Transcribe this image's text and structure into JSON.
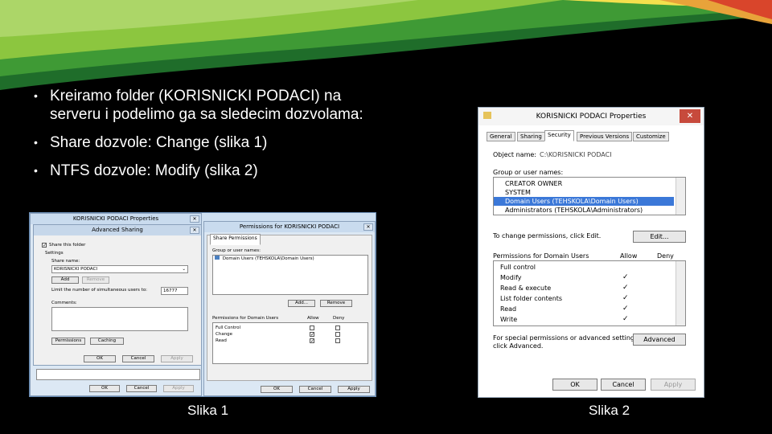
{
  "slide": {
    "bullets": [
      "Kreiramo folder (KORISNICKI PODACI) na serveru i podelimo ga sa sledecim dozvolama:",
      "Share dozvole: Change (slika 1)",
      "NTFS dozvole: Modify (slika 2)"
    ],
    "captions": [
      "Slika 1",
      "Slika 2"
    ]
  },
  "slika1": {
    "bg_title": "KORISNICKI PODACI Properties",
    "adv": {
      "title": "Advanced Sharing",
      "share_this_folder": "Share this folder",
      "settings": "Settings",
      "share_name_label": "Share name:",
      "share_name": "KORISNICKI PODACI",
      "add": "Add",
      "remove": "Remove",
      "limit_label": "Limit the number of simultaneous users to:",
      "limit_value": "16777",
      "comments": "Comments:",
      "permissions": "Permissions",
      "caching": "Caching",
      "ok": "OK",
      "cancel": "Cancel",
      "apply": "Apply"
    },
    "perm": {
      "title": "Permissions for KORISNICKI PODACI",
      "tab": "Share Permissions",
      "group_label": "Group or user names:",
      "group_item": "Domain Users (TEHSKOLA\\Domain Users)",
      "add": "Add...",
      "remove": "Remove",
      "perms_label": "Permissions for Domain Users",
      "allow": "Allow",
      "deny": "Deny",
      "rows": [
        {
          "name": "Full Control",
          "allow": false,
          "deny": false
        },
        {
          "name": "Change",
          "allow": true,
          "deny": false
        },
        {
          "name": "Read",
          "allow": true,
          "deny": false
        }
      ],
      "ok": "OK",
      "cancel": "Cancel",
      "apply": "Apply"
    }
  },
  "slika2": {
    "title": "KORISNICKI PODACI Properties",
    "tabs": [
      "General",
      "Sharing",
      "Security",
      "Previous Versions",
      "Customize"
    ],
    "object_name_label": "Object name:",
    "object_name": "C:\\KORISNICKI PODACI",
    "group_label": "Group or user names:",
    "users": [
      "CREATOR OWNER",
      "SYSTEM",
      "Domain Users (TEHSKOLA\\Domain Users)",
      "Administrators (TEHSKOLA\\Administrators)"
    ],
    "change_text": "To change permissions, click Edit.",
    "edit": "Edit...",
    "perms_label": "Permissions for Domain Users",
    "allow": "Allow",
    "deny": "Deny",
    "perm_rows": [
      {
        "name": "Full control",
        "allow": ""
      },
      {
        "name": "Modify",
        "allow": "✓"
      },
      {
        "name": "Read & execute",
        "allow": "✓"
      },
      {
        "name": "List folder contents",
        "allow": "✓"
      },
      {
        "name": "Read",
        "allow": "✓"
      },
      {
        "name": "Write",
        "allow": "✓"
      }
    ],
    "special_text_1": "For special permissions or advanced settings,",
    "special_text_2": "click Advanced.",
    "advanced": "Advanced",
    "ok": "OK",
    "cancel": "Cancel",
    "apply": "Apply"
  }
}
